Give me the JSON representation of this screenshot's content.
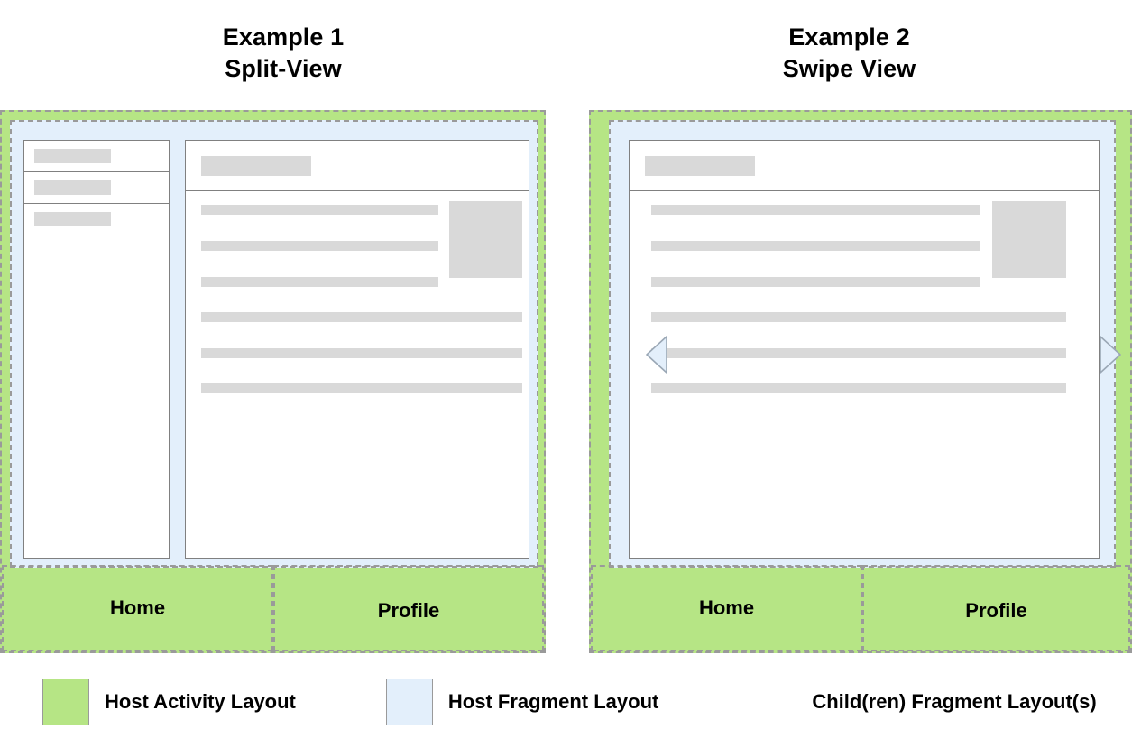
{
  "examples": [
    {
      "title_line1": "Example 1",
      "title_line2": "Split-View",
      "nav": {
        "home": "Home",
        "profile": "Profile"
      }
    },
    {
      "title_line1": "Example 2",
      "title_line2": "Swipe View",
      "nav": {
        "home": "Home",
        "profile": "Profile"
      }
    }
  ],
  "legend": {
    "items": [
      {
        "label": "Host Activity Layout",
        "color": "#b6e585"
      },
      {
        "label": "Host Fragment Layout",
        "color": "#e3effb"
      },
      {
        "label": "Child(ren) Fragment Layout(s)",
        "color": "#ffffff"
      }
    ]
  },
  "colors": {
    "host_activity": "#b6e585",
    "host_fragment": "#e3effb",
    "child_fragment": "#ffffff",
    "placeholder": "#d9d9d9",
    "border": "#808080",
    "dashed_border": "#9a9a9a",
    "arrow_fill": "#e3effb"
  }
}
